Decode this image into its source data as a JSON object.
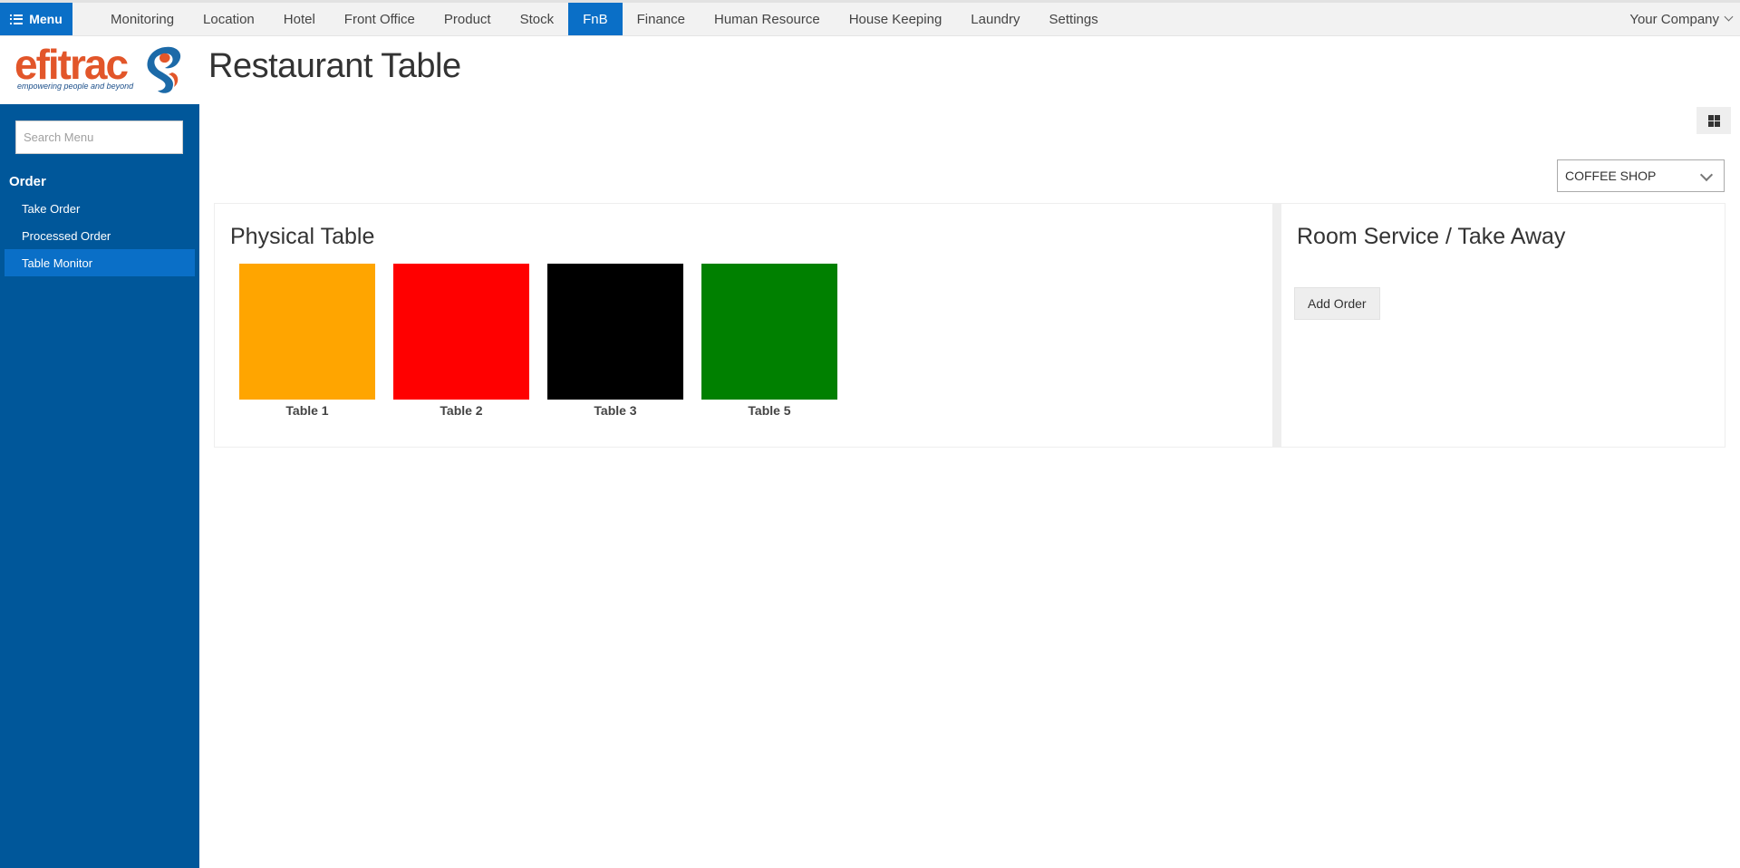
{
  "topbar": {
    "menu_label": "Menu",
    "nav_items": [
      {
        "label": "Monitoring"
      },
      {
        "label": "Location"
      },
      {
        "label": "Hotel"
      },
      {
        "label": "Front Office"
      },
      {
        "label": "Product"
      },
      {
        "label": "Stock"
      },
      {
        "label": "FnB",
        "active": true
      },
      {
        "label": "Finance"
      },
      {
        "label": "Human Resource"
      },
      {
        "label": "House Keeping"
      },
      {
        "label": "Laundry"
      },
      {
        "label": "Settings"
      }
    ],
    "company_label": "Your Company"
  },
  "logo": {
    "wordmark": "efitrac",
    "tagline": "empowering people and beyond",
    "colors": {
      "primary": "#e2562a",
      "secondary": "#1c6aa8"
    }
  },
  "page": {
    "title": "Restaurant Table"
  },
  "sidebar": {
    "search_placeholder": "Search Menu",
    "section_title": "Order",
    "items": [
      {
        "label": "Take Order"
      },
      {
        "label": "Processed Order"
      },
      {
        "label": "Table Monitor",
        "active": true
      }
    ],
    "background": "#00579a"
  },
  "toolbar": {
    "view_icon": "grid-icon",
    "outlet_select": {
      "value": "COFFEE SHOP"
    }
  },
  "physical_table": {
    "heading": "Physical Table",
    "tables": [
      {
        "label": "Table 1",
        "color": "#ffa500"
      },
      {
        "label": "Table 2",
        "color": "#ff0000"
      },
      {
        "label": "Table 3",
        "color": "#000000"
      },
      {
        "label": "Table 5",
        "color": "#008000"
      }
    ]
  },
  "room_service": {
    "heading": "Room Service / Take Away",
    "add_order_label": "Add Order"
  },
  "colors": {
    "accent": "#0a6fc7",
    "sidebar": "#00579a"
  }
}
